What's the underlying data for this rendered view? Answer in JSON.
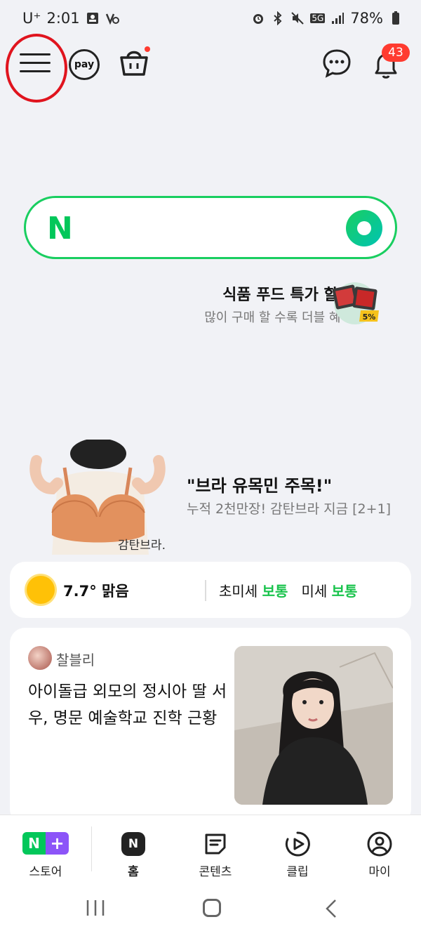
{
  "status_bar": {
    "carrier": "U⁺",
    "time": "2:01",
    "network": "5G",
    "battery": "78%"
  },
  "top_bar": {
    "pay_label": "pay",
    "notification_count": "43"
  },
  "search": {
    "logo": "N"
  },
  "promo_food": {
    "title": "식품 푸드 특가 할인",
    "subtitle": "많이 구매 할 수록 더블 혜택",
    "badge": "5%"
  },
  "promo_bra": {
    "title": "\"브라 유목민 주목!\"",
    "subtitle": "누적 2천만장! 감탄브라 지금 [2+1]",
    "image_caption": "감탄브라."
  },
  "weather": {
    "temperature": "7.7°",
    "condition": "맑음",
    "fine_dust_label": "초미세",
    "fine_dust_value": "보통",
    "dust_label": "미세",
    "dust_value": "보통"
  },
  "news": {
    "author": "찰블리",
    "headline": "아이돌급 외모의 정시아 딸 서우, 명문 예술학교 진학 근황"
  },
  "bottom_nav": {
    "items": [
      {
        "label": "스토어"
      },
      {
        "label": "홈"
      },
      {
        "label": "콘텐츠"
      },
      {
        "label": "클립"
      },
      {
        "label": "마이"
      }
    ],
    "store_logo_n": "N",
    "store_logo_plus": "+",
    "home_icon_letter": "N"
  },
  "colors": {
    "naver_green": "#03c75a",
    "badge_red": "#ff3b30",
    "highlight_circle": "#e0141e",
    "good_status": "#19c34c"
  }
}
